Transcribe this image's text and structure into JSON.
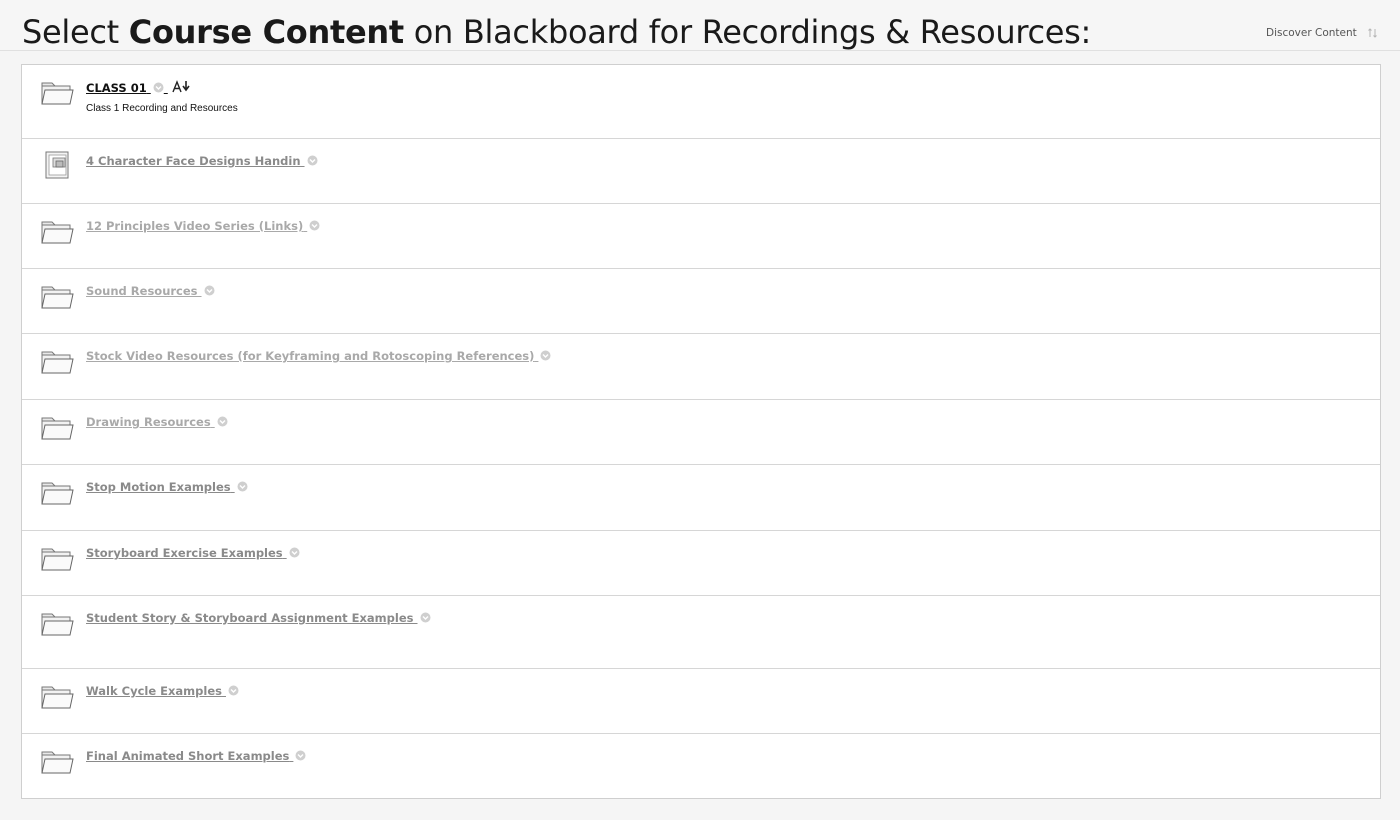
{
  "header": {
    "title_prefix": "Select ",
    "title_bold": "Course Content",
    "title_suffix": " on Blackboard for Recordings & Resources:",
    "discover_label": "Discover Content",
    "sort_icon": "sort-arrows-icon"
  },
  "items": [
    {
      "title": "CLASS 01",
      "description": "Class 1 Recording and Resources",
      "icon": "folder-icon"
    },
    {
      "title": "4 Character Face Designs Handin",
      "icon": "assignment-icon"
    },
    {
      "title": "12 Principles Video Series (Links)",
      "icon": "folder-icon"
    },
    {
      "title": "Sound Resources",
      "icon": "folder-icon"
    },
    {
      "title": "Stock Video Resources (for Keyframing and Rotoscoping References)",
      "icon": "folder-icon"
    },
    {
      "title": "Drawing Resources",
      "icon": "folder-icon"
    },
    {
      "title": "Stop Motion Examples",
      "icon": "folder-icon"
    },
    {
      "title": "Storyboard Exercise Examples",
      "icon": "folder-icon"
    },
    {
      "title": "Student Story & Storyboard Assignment Examples",
      "icon": "folder-icon"
    },
    {
      "title": "Walk Cycle Examples",
      "icon": "folder-icon"
    },
    {
      "title": "Final Animated Short Examples",
      "icon": "folder-icon"
    }
  ],
  "colors": {
    "active_title": "#111111",
    "dim_title": "#8a8a8a",
    "faint_title": "#a9a9a9"
  }
}
